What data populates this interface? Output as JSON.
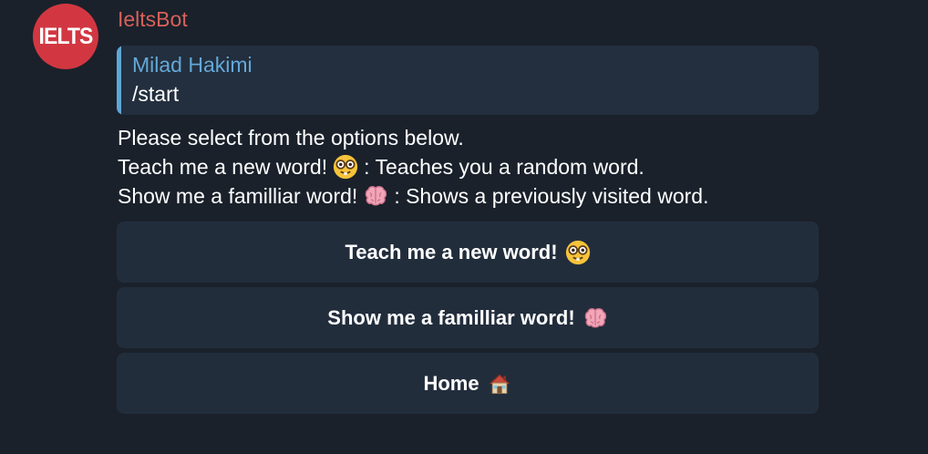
{
  "bot": {
    "avatar_text": "IELTS",
    "name": "IeltsBot",
    "avatar_color": "#d23741",
    "name_color": "#d8615a"
  },
  "reply": {
    "author": "Milad Hakimi",
    "text": "/start",
    "accent_color": "#60a6d6"
  },
  "message": {
    "line1": "Please select from the options below.",
    "line2_before": "Teach me a new word!",
    "line2_after": ": Teaches you a random word.",
    "line3_before": "Show me a familliar word!",
    "line3_after": ": Shows a previously visited word."
  },
  "keyboard": {
    "buttons": [
      {
        "label": "Teach me a new word!",
        "icon": "nerd-face-icon"
      },
      {
        "label": "Show me a familliar word!",
        "icon": "brain-icon"
      },
      {
        "label": "Home",
        "icon": "house-icon"
      }
    ]
  },
  "colors": {
    "background": "#1a212b",
    "bubble": "#232f3e",
    "button": "#222d3c"
  }
}
